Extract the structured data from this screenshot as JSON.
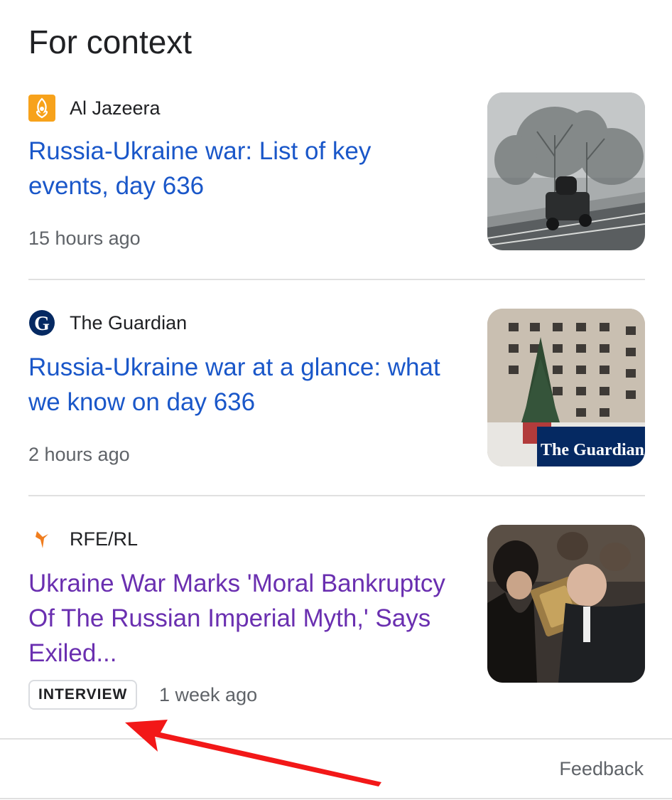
{
  "section": {
    "title": "For context"
  },
  "articles": [
    {
      "source": "Al Jazeera",
      "source_icon": "al-jazeera-logo-icon",
      "title": "Russia-Ukraine war: List of key events, day 636",
      "time": "15 hours ago",
      "thumbnail": "snowy-road-vehicle-photo"
    },
    {
      "source": "The Guardian",
      "source_icon": "guardian-logo-icon",
      "title": "Russia-Ukraine war at a glance: what we know on day 636",
      "time": "2 hours ago",
      "thumbnail": "damaged-apartment-building-photo",
      "thumbnail_overlay": "The Guardian"
    },
    {
      "source": "RFE/RL",
      "source_icon": "rferl-logo-icon",
      "title": "Ukraine War Marks 'Moral Bankruptcy Of The Russian Imperial Myth,' Says Exiled...",
      "badge": "INTERVIEW",
      "time": "1 week ago",
      "thumbnail": "man-kissing-icon-photo"
    }
  ],
  "footer": {
    "feedback": "Feedback"
  },
  "colors": {
    "link": "#1a57c9",
    "visited_link": "#6a2fb0",
    "annotation_arrow": "#f21818"
  }
}
